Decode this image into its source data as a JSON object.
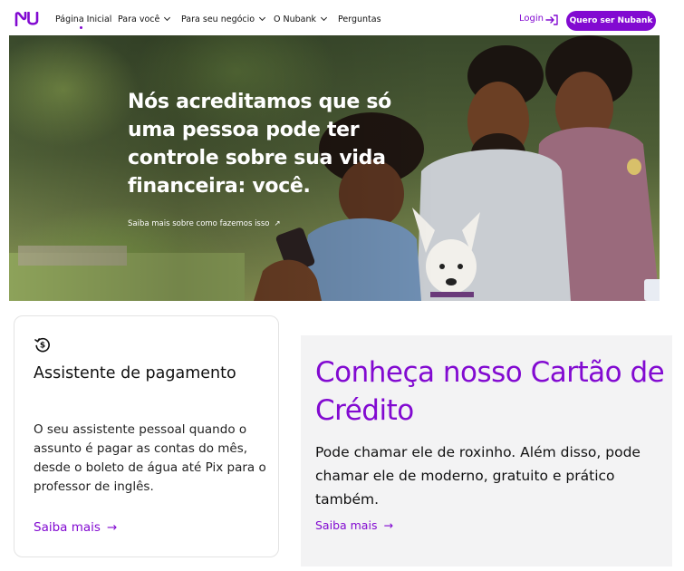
{
  "nav": {
    "brand_icon": "nubank-logo",
    "links": [
      {
        "label": "Página Inicial",
        "dropdown": false
      },
      {
        "label": "Para você",
        "dropdown": true
      },
      {
        "label": "Para seu negócio",
        "dropdown": true
      },
      {
        "label": "O Nubank",
        "dropdown": true
      },
      {
        "label": "Perguntas",
        "dropdown": false
      }
    ],
    "login_label": "Login",
    "login_icon": "login-arrow-icon",
    "cta_label": "Quero ser Nubank"
  },
  "hero": {
    "title": "Nós acreditamos que só uma pessoa pode ter controle sobre sua vida financeira: você.",
    "link_label": "Saiba mais sobre como fazemos isso",
    "link_arrow": "↗"
  },
  "card": {
    "icon": "payment-cycle-icon",
    "title": "Assistente de pagamento",
    "body": "O seu assistente pessoal quando o assunto é pagar as contas do mês, desde o boleto de água até Pix para o professor de inglês.",
    "link_label": "Saiba mais",
    "link_arrow": "→"
  },
  "promo": {
    "title": "Conheça nosso Cartão de Crédito",
    "body": "Pode chamar ele de roxinho. Além disso, pode chamar ele de moderno, gratuito e prático também.",
    "link_label": "Saiba mais",
    "link_arrow": "→"
  },
  "colors": {
    "brand": "#820ad1",
    "promo_bg": "#f3f3f4",
    "text": "#111111"
  }
}
